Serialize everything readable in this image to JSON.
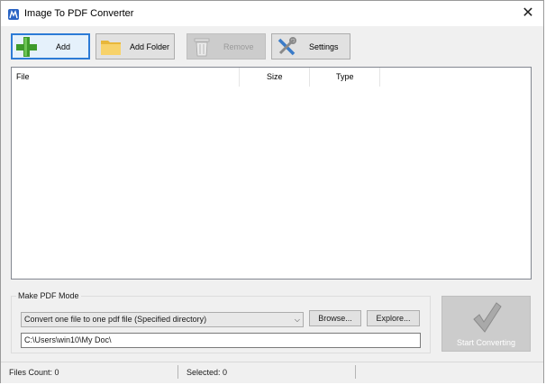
{
  "window": {
    "title": "Image To PDF Converter",
    "close_glyph": "✕"
  },
  "toolbar": {
    "add_label": "Add",
    "add_folder_label": "Add Folder",
    "remove_label": "Remove",
    "settings_label": "Settings"
  },
  "file_list": {
    "columns": [
      "File",
      "Size",
      "Type"
    ],
    "rows": []
  },
  "pdf_mode": {
    "group_title": "Make PDF Mode",
    "selected_option": "Convert one file to one pdf file (Specified directory)",
    "browse_label": "Browse...",
    "explore_label": "Explore...",
    "output_path": "C:\\Users\\win10\\My Doc\\"
  },
  "start": {
    "label": "Start Converting",
    "enabled": false
  },
  "status": {
    "files_count": "Files Count: 0",
    "selected": "Selected: 0"
  },
  "colors": {
    "accent": "#2c7bd6",
    "window_bg": "#f0f0f0",
    "disabled_bg": "#cccccc",
    "add_icon_green": "#3d9a2b",
    "folder_yellow": "#e8b73a"
  },
  "icons": {
    "app": "app-logo-icon",
    "add": "green-plus-icon",
    "add_folder": "folder-icon",
    "remove": "trash-can-icon",
    "settings": "tools-icon",
    "start": "checkmark-icon"
  }
}
